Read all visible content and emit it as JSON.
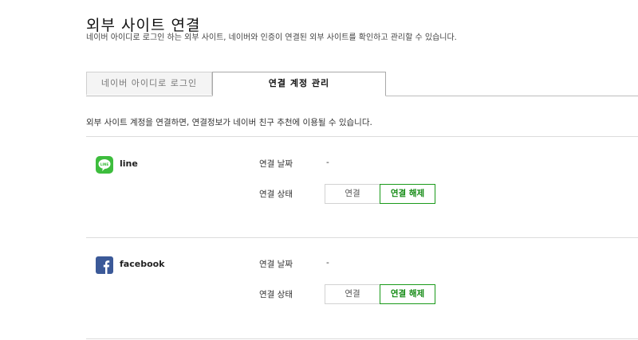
{
  "header": {
    "title": "외부 사이트 연결",
    "description": "네이버 아이디로 로그인 하는 외부 사이트, 네이버와 인증이 연결된 외부 사이트를 확인하고 관리할 수 있습니다."
  },
  "tabs": [
    {
      "label": "네이버 아이디로 로그인",
      "active": false
    },
    {
      "label": "연결 계정 관리",
      "active": true
    }
  ],
  "notice": "외부 사이트 계정을 연결하면, 연결정보가 네이버 친구 추천에 이용될 수 있습니다.",
  "accounts": [
    {
      "service": "line",
      "icon": "line-icon",
      "icon_color": "#3dbd3d",
      "date_label": "연결 날짜",
      "date_value": "-",
      "status_label": "연결 상태",
      "connect_label": "연결",
      "disconnect_label": "연결 해제"
    },
    {
      "service": "facebook",
      "icon": "facebook-icon",
      "icon_color": "#3b5998",
      "date_label": "연결 날짜",
      "date_value": "-",
      "status_label": "연결 상태",
      "connect_label": "연결",
      "disconnect_label": "연결 해제"
    }
  ],
  "colors": {
    "accent_green": "#1a9a1a",
    "divider": "#dcdcdc"
  }
}
